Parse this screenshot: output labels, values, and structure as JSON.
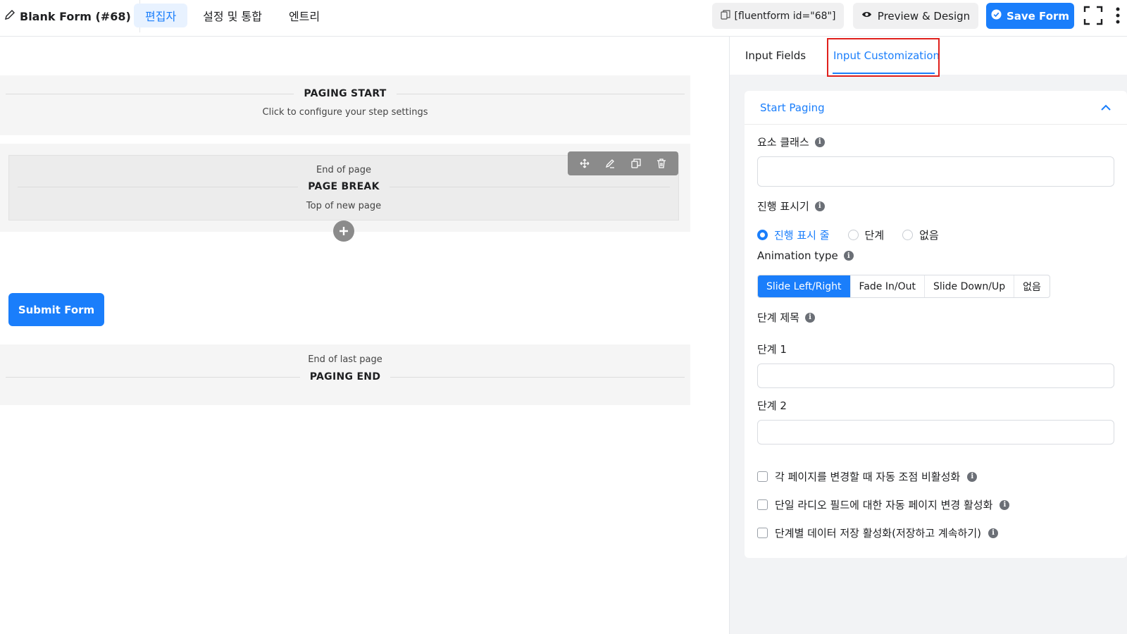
{
  "header": {
    "form_title": "Blank Form (#68)",
    "tabs": [
      {
        "label": "편집자"
      },
      {
        "label": "설정 및 통합"
      },
      {
        "label": "엔트리"
      }
    ],
    "shortcode": "[fluentform id=\"68\"]",
    "preview_label": "Preview & Design",
    "save_label": "Save Form"
  },
  "editor": {
    "paging_start": {
      "title": "PAGING START",
      "subtitle": "Click to configure your step settings"
    },
    "page_break": {
      "top_text": "End of page",
      "title": "PAGE BREAK",
      "bottom_text": "Top of new page"
    },
    "submit_label": "Submit Form",
    "paging_end": {
      "top_text": "End of last page",
      "title": "PAGING END"
    }
  },
  "panel": {
    "tabs": [
      {
        "label": "Input Fields"
      },
      {
        "label": "Input Customization"
      }
    ],
    "section_title": "Start Paging",
    "element_class_label": "요소 클래스",
    "element_class_value": "",
    "progress_indicator_label": "진행 표시기",
    "progress_options": [
      {
        "label": "진행 표시 줄"
      },
      {
        "label": "단계"
      },
      {
        "label": "없음"
      }
    ],
    "animation_type_label": "Animation type",
    "animation_options": [
      {
        "label": "Slide Left/Right"
      },
      {
        "label": "Fade In/Out"
      },
      {
        "label": "Slide Down/Up"
      },
      {
        "label": "없음"
      }
    ],
    "step_titles_label": "단계 제목",
    "step1_label": "단계 1",
    "step1_value": "",
    "step2_label": "단계 2",
    "step2_value": "",
    "checkboxes": [
      {
        "label": "각 페이지를 변경할 때 자동 조점 비활성화"
      },
      {
        "label": "단일 라디오 필드에 대한 자동 페이지 변경 활성화"
      },
      {
        "label": "단계별 데이터 저장 활성화(저장하고 계속하기)"
      }
    ],
    "colors": {
      "accent": "#1a7efb",
      "highlight": "#e0201c"
    }
  }
}
